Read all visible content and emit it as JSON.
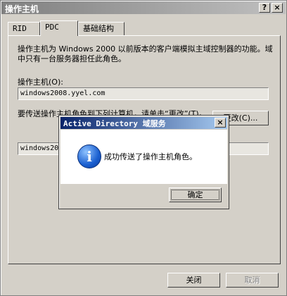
{
  "window": {
    "title": "操作主机",
    "help": "?",
    "close": "×"
  },
  "tabs": [
    {
      "label": "RID"
    },
    {
      "label": "PDC"
    },
    {
      "label": "基础结构"
    }
  ],
  "panel": {
    "description": "操作主机为 Windows 2000 以前版本的客户端模拟主域控制器的功能。域中只有一台服务器担任此角色。",
    "operations_master_label": "操作主机(O):",
    "operations_master_value": "windows2008.yyel.com",
    "transfer_label": "要传送操作主机角色到下列计算机，请单击“更改”(T)。",
    "change_button": "更改(C)...",
    "target_value": "windows2008.yyel.com"
  },
  "footer": {
    "close_button": "关闭",
    "cancel_button": "取消"
  },
  "dialog": {
    "title": "Active Directory 域服务",
    "close": "×",
    "message": "成功传送了操作主机角色。",
    "ok_button": "确定",
    "icon": "info-icon"
  }
}
